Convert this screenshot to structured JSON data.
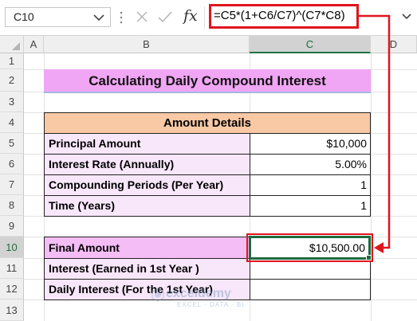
{
  "formula_bar": {
    "name_box": "C10",
    "fx_label": "fx",
    "formula": "=C5*(1+C6/C7)^(C7*C8)"
  },
  "columns": [
    "A",
    "B",
    "C",
    "D"
  ],
  "active_column": "C",
  "rows": [
    "1",
    "2",
    "3",
    "4",
    "5",
    "6",
    "7",
    "8",
    "9",
    "10",
    "11",
    "12",
    "13"
  ],
  "active_row": "10",
  "sheet": {
    "title": "Calculating Daily Compound Interest",
    "details_header": "Amount Details",
    "details": [
      {
        "label": "Principal Amount",
        "value": "$10,000"
      },
      {
        "label": "Interest Rate (Annually)",
        "value": "5.00%"
      },
      {
        "label": "Compounding Periods (Per Year)",
        "value": "1"
      },
      {
        "label": "Time (Years)",
        "value": "1"
      }
    ],
    "results": [
      {
        "label": "Final Amount",
        "value": "$10,500.00"
      },
      {
        "label": "Interest (Earned in 1st Year )",
        "value": ""
      },
      {
        "label": "Daily Interest (For the 1st Year)",
        "value": ""
      }
    ]
  },
  "watermark": {
    "name": "exceldemy",
    "tagline": "EXCEL · DATA · BI"
  },
  "colors": {
    "title_fill": "#f0a6f4",
    "header_fill": "#f9c9a6",
    "label_fill": "#f8e6fa",
    "final_label_fill": "#f4bdf5",
    "selection": "#1d6b3e",
    "callout": "#e0141e"
  }
}
